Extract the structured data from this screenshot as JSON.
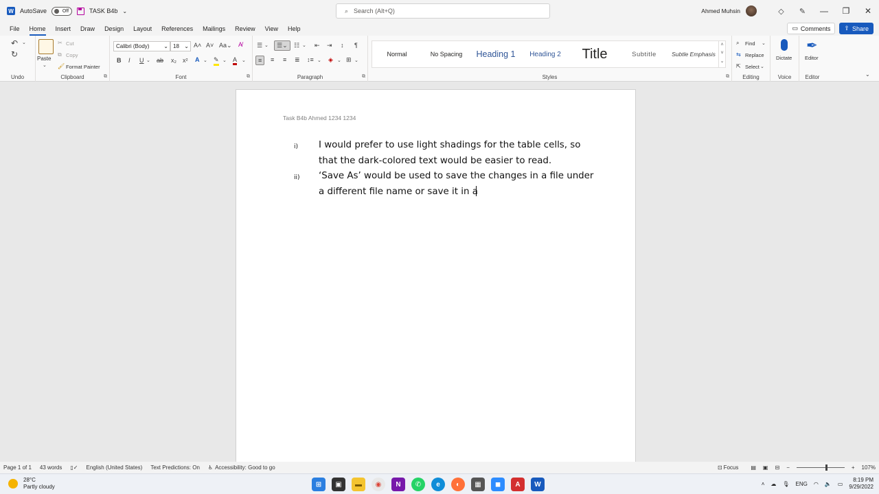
{
  "titlebar": {
    "autosave_label": "AutoSave",
    "autosave_state": "Off",
    "doc_name": "TASK B4b",
    "search_placeholder": "Search (Alt+Q)",
    "user_name": "Ahmed Muhsin"
  },
  "menu": {
    "tabs": [
      "File",
      "Home",
      "Insert",
      "Draw",
      "Design",
      "Layout",
      "References",
      "Mailings",
      "Review",
      "View",
      "Help"
    ],
    "active": "Home",
    "comments": "Comments",
    "share": "Share"
  },
  "ribbon": {
    "undo_label": "Undo",
    "clipboard": {
      "label": "Clipboard",
      "paste": "Paste",
      "cut": "Cut",
      "copy": "Copy",
      "format_painter": "Format Painter"
    },
    "font": {
      "label": "Font",
      "family": "Calibri (Body)",
      "size": "18"
    },
    "paragraph": {
      "label": "Paragraph"
    },
    "styles": {
      "label": "Styles",
      "items": [
        "Normal",
        "No Spacing",
        "Heading 1",
        "Heading 2",
        "Title",
        "Subtitle",
        "Subtle Emphasis"
      ]
    },
    "editing": {
      "label": "Editing",
      "find": "Find",
      "replace": "Replace",
      "select": "Select"
    },
    "voice": {
      "label": "Voice",
      "dictate": "Dictate"
    },
    "editor": {
      "label": "Editor",
      "editor": "Editor"
    }
  },
  "document": {
    "header": "Task B4b Ahmed 1234 1234",
    "items": [
      {
        "num": "i)",
        "text": "I would prefer to use light shadings for the table cells, so that the dark-colored text would be easier to read."
      },
      {
        "num": "ii)",
        "text": "‘Save As’ would be used to save the changes in a file under a different file name or save it in a"
      }
    ]
  },
  "status": {
    "page": "Page 1 of 1",
    "words": "43 words",
    "language": "English (United States)",
    "predictions": "Text Predictions: On",
    "accessibility": "Accessibility: Good to go",
    "focus": "Focus",
    "zoom": "107%"
  },
  "taskbar": {
    "temp": "28°C",
    "weather": "Partly cloudy",
    "lang": "ENG",
    "time": "8:19 PM",
    "date": "9/29/2022"
  },
  "colors": {
    "word_blue": "#185abd",
    "accent_active": "#185abd"
  }
}
